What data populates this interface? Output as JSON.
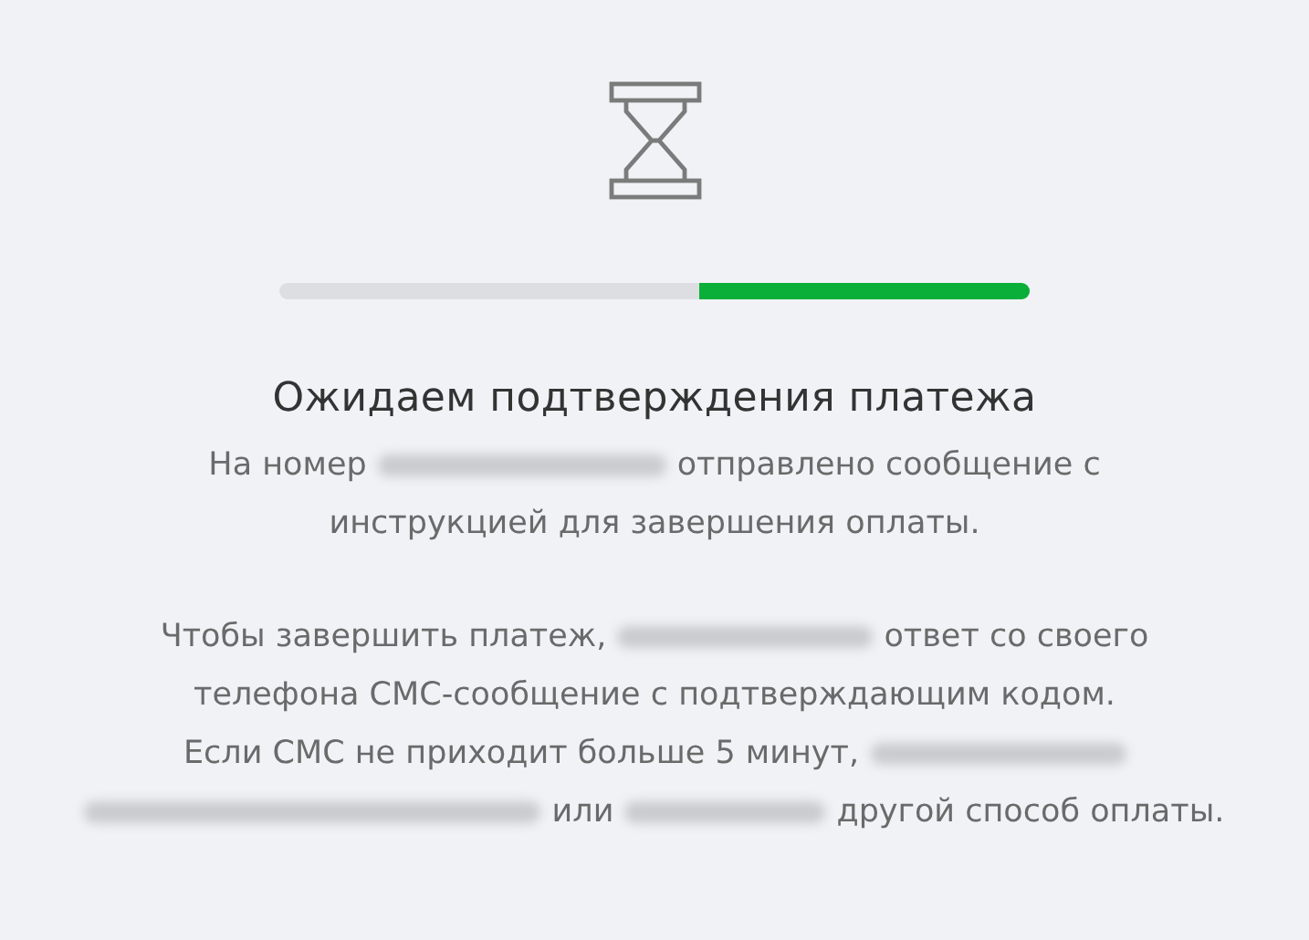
{
  "progress": {
    "level": 0.44
  },
  "title": "Ожидаем подтверждения платежа",
  "paragraphs": [
    {
      "lines": [
        [
          {
            "kind": "text",
            "text": "На номер"
          },
          {
            "kind": "redactedlong"
          },
          {
            "kind": "text",
            "text": "отправлено сообщение с"
          }
        ],
        [
          {
            "kind": "text",
            "text": "инструкцией для завершения оплаты."
          }
        ]
      ]
    },
    {
      "lines": [
        [
          {
            "kind": "text",
            "text": "Чтобы завершить платеж,"
          },
          {
            "kind": "redacted"
          },
          {
            "kind": "text",
            "text": "ответ со своего"
          }
        ],
        [
          {
            "kind": "text",
            "text": "телефона СМС-сообщение с подтверждающим кодом."
          }
        ],
        [
          {
            "kind": "text",
            "text": "Если СМС не приходит больше 5 минут,"
          },
          {
            "kind": "redacted"
          }
        ],
        [
          {
            "kind": "redactedwide"
          },
          {
            "kind": "text",
            "text": "или"
          },
          {
            "kind": "redactedshort"
          },
          {
            "kind": "text",
            "text": "другой способ оплаты."
          }
        ]
      ]
    }
  ]
}
